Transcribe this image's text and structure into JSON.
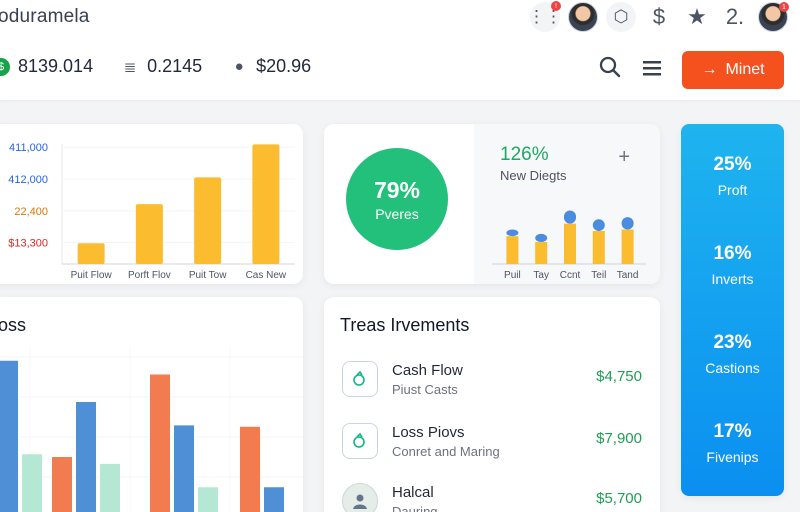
{
  "header": {
    "brand": "oduramela",
    "icons": [
      {
        "name": "apps-grid-icon",
        "glyph": "⋮⋮",
        "badge": "!"
      },
      {
        "name": "user-avatar",
        "glyph": ""
      },
      {
        "name": "cube-icon",
        "glyph": "⬡"
      },
      {
        "name": "dollar-icon",
        "glyph": "$"
      },
      {
        "name": "star-icon",
        "glyph": "★"
      },
      {
        "name": "two-icon",
        "glyph": "2."
      }
    ],
    "profile_badge": "1",
    "stats": [
      {
        "icon": "coin-icon",
        "glyph": "$",
        "value": "8139.014"
      },
      {
        "icon": "stack-icon",
        "glyph": "≣",
        "value": "0.2145"
      },
      {
        "icon": "mic-icon",
        "glyph": "●",
        "value": "$20.96"
      }
    ],
    "primary_button": {
      "arrow": "→",
      "label": "Minet"
    }
  },
  "chart_data": [
    {
      "type": "bar",
      "categories": [
        "Puit Flow",
        "Porft Flov",
        "Puit Tow",
        "Cas New"
      ],
      "values": [
        19800,
        32100,
        40500,
        50900
      ],
      "yticks": [
        {
          "label": "411,000",
          "value": 50000,
          "color": "#2563eb"
        },
        {
          "label": "412,000",
          "value": 40000,
          "color": "#2563eb"
        },
        {
          "label": "22,400",
          "value": 30000,
          "color": "#d97706"
        },
        {
          "label": "$13,300",
          "value": 20000,
          "color": "#dc2626"
        }
      ],
      "ylim": [
        13300,
        51000
      ],
      "color": "#fbbd2f"
    },
    {
      "type": "bar",
      "categories": [
        "Puil",
        "Tay",
        "Ccnt",
        "Teil",
        "Tand"
      ],
      "series": [
        {
          "values": [
            38,
            30,
            55,
            45,
            47
          ],
          "color": "#fbbd2f"
        },
        {
          "values": [
            18,
            22,
            36,
            32,
            34
          ],
          "color": "#4a8ce0"
        }
      ],
      "ylim": [
        0,
        60
      ]
    },
    {
      "type": "bar",
      "series": [
        {
          "values": [
            110,
            80,
            63,
            18
          ],
          "color": "#4f8fd6"
        },
        {
          "values": [
            40,
            100,
            62,
            16
          ],
          "color": "#f27b4f"
        },
        {
          "values": [
            42,
            35,
            18
          ],
          "color": "#b5e8d4"
        }
      ],
      "ylim": [
        0,
        120
      ]
    }
  ],
  "kpi_circle": {
    "value": "79%",
    "label": "Pveres"
  },
  "kpi_side": {
    "value": "126%",
    "label": "New Diegts",
    "plus": "+"
  },
  "blue_panel": [
    {
      "value": "25%",
      "label": "Proft"
    },
    {
      "value": "16%",
      "label": "Inverts"
    },
    {
      "value": "23%",
      "label": "Castions"
    },
    {
      "value": "17%",
      "label": "Fivenips"
    }
  ],
  "loss": {
    "title": "oss"
  },
  "transactions": {
    "title": "Treas Irvements",
    "rows": [
      {
        "name": "Cash Flow",
        "sub": "Piust Casts",
        "amount": "$4,750"
      },
      {
        "name": "Loss Piovs",
        "sub": "Conret and Maring",
        "amount": "$7,900"
      },
      {
        "name": "Halcal",
        "sub": "Dauring",
        "amount": "$5,700"
      }
    ]
  }
}
